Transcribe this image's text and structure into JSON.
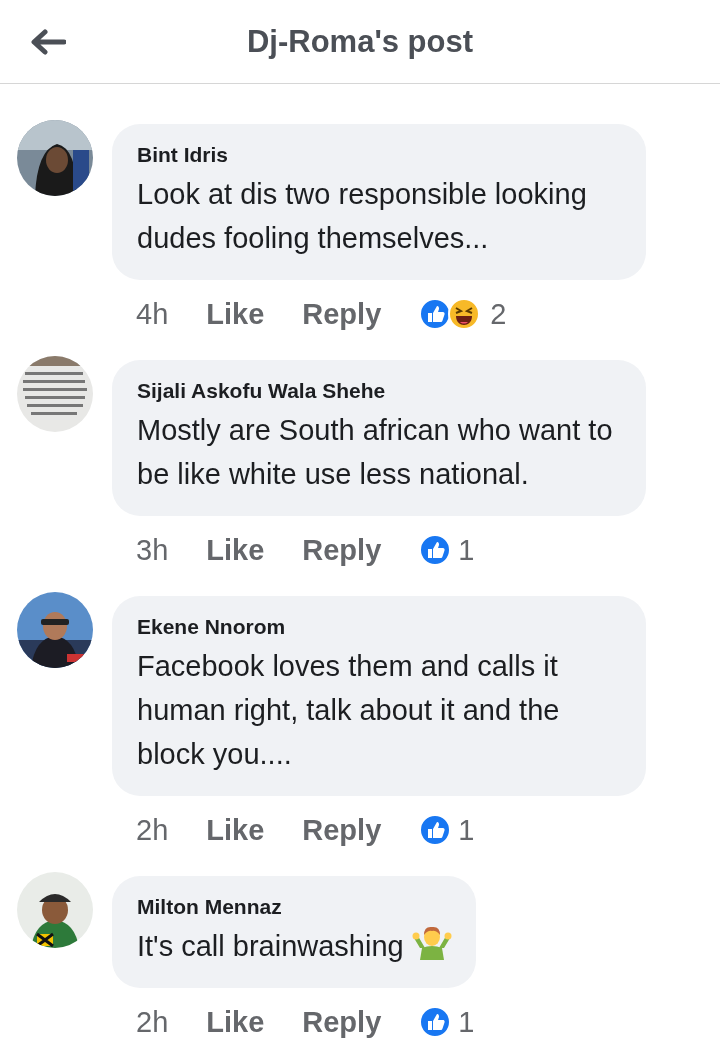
{
  "header": {
    "title": "Dj-Roma's post"
  },
  "comments": [
    {
      "author": "Bint Idris",
      "text": "Look at dis two responsible looking dudes fooling themselves...",
      "time": "4h",
      "like_label": "Like",
      "reply_label": "Reply",
      "reactions": [
        {
          "kind": "like"
        },
        {
          "kind": "haha"
        }
      ],
      "reaction_count": "2",
      "avatar": {
        "kind": "picture"
      }
    },
    {
      "author": "Sijali Askofu Wala Shehe",
      "text": "Mostly are South african who want to be like white use less national.",
      "time": "3h",
      "like_label": "Like",
      "reply_label": "Reply",
      "reactions": [
        {
          "kind": "like"
        }
      ],
      "reaction_count": "1",
      "avatar": {
        "kind": "picture"
      }
    },
    {
      "author": "Ekene Nnorom",
      "text": "Facebook loves them and calls it human right, talk about it and the block you....",
      "time": "2h",
      "like_label": "Like",
      "reply_label": "Reply",
      "reactions": [
        {
          "kind": "like"
        }
      ],
      "reaction_count": "1",
      "avatar": {
        "kind": "picture"
      }
    },
    {
      "author": "Milton Mennaz",
      "text": "It's call brainwashing",
      "emoji": {
        "kind": "shrug"
      },
      "time": "2h",
      "like_label": "Like",
      "reply_label": "Reply",
      "reactions": [
        {
          "kind": "like"
        }
      ],
      "reaction_count": "1",
      "avatar": {
        "kind": "picture"
      }
    }
  ]
}
